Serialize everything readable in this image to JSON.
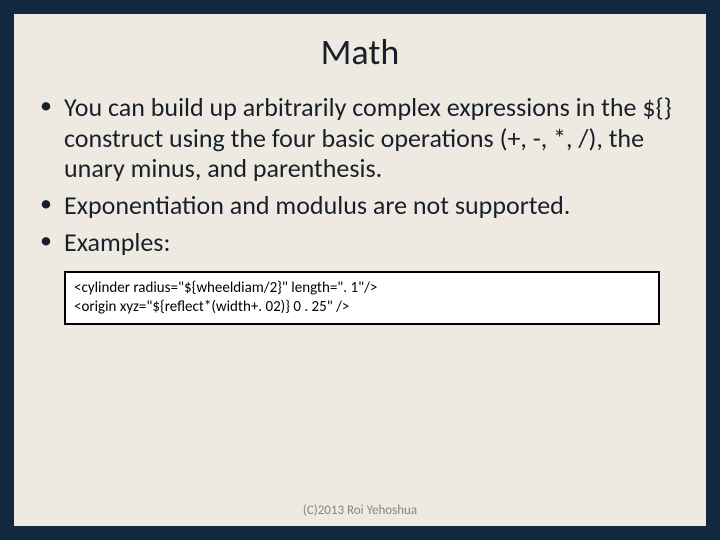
{
  "title": "Math",
  "bullets": [
    "You can build up arbitrarily complex expressions in the ${} construct using the four basic operations (+, -, *, /), the unary minus, and parenthesis.",
    "Exponentiation and modulus are not supported.",
    "Examples:"
  ],
  "code": {
    "line1": "<cylinder radius=\"${wheeldiam/2}\" length=\". 1\"/>",
    "line2": "<origin xyz=\"${reflect*(width+. 02)} 0 . 25\" />"
  },
  "footer": "(C)2013 Roi Yehoshua"
}
